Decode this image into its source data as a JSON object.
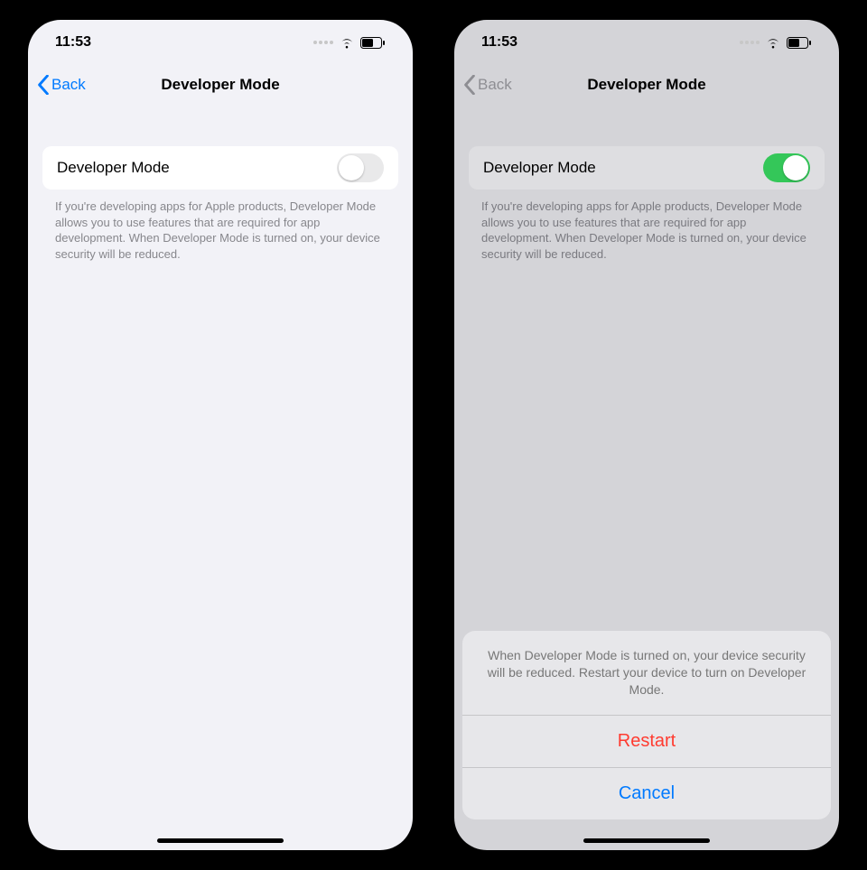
{
  "status": {
    "time": "11:53"
  },
  "nav": {
    "back": "Back",
    "title": "Developer Mode"
  },
  "row": {
    "label": "Developer Mode"
  },
  "footer": "If you're developing apps for Apple products, Developer Mode allows you to use features that are required for app development. When Developer Mode is turned on, your device security will be reduced.",
  "sheet": {
    "message": "When Developer Mode is turned on, your device security will be reduced. Restart your device to turn on Developer Mode.",
    "restart": "Restart",
    "cancel": "Cancel"
  },
  "toggle": {
    "left": "off",
    "right": "on"
  }
}
